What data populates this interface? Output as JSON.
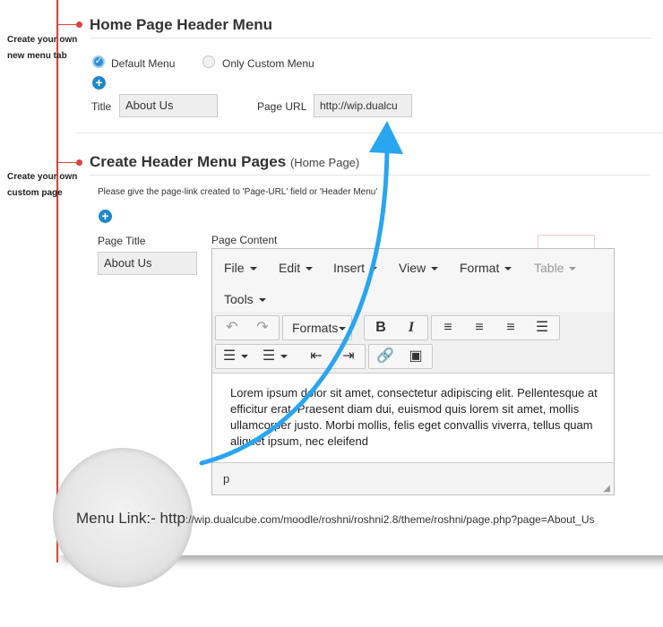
{
  "annotations": {
    "menu_tab_note": "Create your own new menu tab",
    "custom_page_note": "Create your own custom page"
  },
  "header_menu": {
    "title": "Home Page Header Menu",
    "default_menu_label": "Default Menu",
    "only_custom_label": "Only Custom Menu",
    "title_label": "Title",
    "title_value": "About Us",
    "page_url_label": "Page URL",
    "page_url_value": "http://wip.dualcu"
  },
  "menu_pages": {
    "title": "Create Header Menu Pages",
    "subtitle": "(Home Page)",
    "instruction": "Please give the page-link created to 'Page-URL' field or 'Header Menu'",
    "page_title_label": "Page Title",
    "page_title_value": "About Us",
    "page_content_label": "Page Content"
  },
  "editor": {
    "menus": [
      "File",
      "Edit",
      "Insert",
      "View",
      "Format",
      "Table",
      "Tools"
    ],
    "formats_label": "Formats",
    "content": "Lorem ipsum dolor sit amet, consectetur adipiscing elit. Pellentesque at efficitur erat. Praesent diam dui, euismod quis lorem sit amet, mollis ullamcorper justo. Morbi mollis, felis eget convallis viverra, tellus quam aliquet ipsum, nec eleifend",
    "status_path": "p"
  },
  "menu_link": {
    "label": "Menu Link:- http",
    "url": "://wip.dualcube.com/moodle/roshni/roshni2.8/theme/roshni/page.php?page=About_Us"
  },
  "colors": {
    "accent_red": "#d9443b",
    "arrow_blue": "#2aa5ef",
    "radio_blue": "#2d8fd5"
  }
}
